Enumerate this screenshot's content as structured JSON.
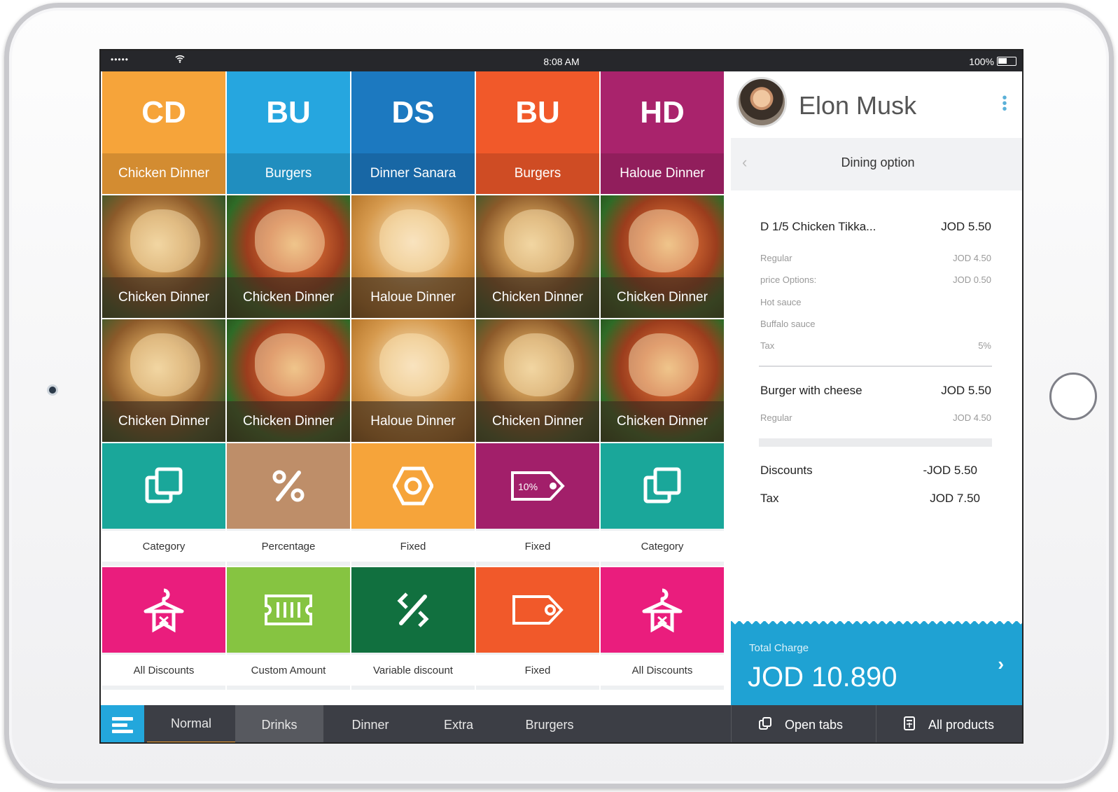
{
  "status_bar": {
    "signal": "•••••",
    "time": "8:08 AM",
    "battery": "100%"
  },
  "category_tiles": [
    {
      "abbr": "CD",
      "label": "Chicken Dinner",
      "color": "#f6a43a"
    },
    {
      "abbr": "BU",
      "label": "Burgers",
      "color": "#26a6df"
    },
    {
      "abbr": "DS",
      "label": "Dinner Sanara",
      "color": "#1c79c0"
    },
    {
      "abbr": "BU",
      "label": "Burgers",
      "color": "#f1592a"
    },
    {
      "abbr": "HD",
      "label": "Haloue Dinner",
      "color": "#a9236c"
    }
  ],
  "product_tiles_row1": [
    "Chicken Dinner",
    "Chicken Dinner",
    "Haloue Dinner",
    "Chicken Dinner",
    "Chicken Dinner"
  ],
  "product_tiles_row2": [
    "Chicken Dinner",
    "Chicken Dinner",
    "Haloue Dinner",
    "Chicken Dinner",
    "Chicken Dinner"
  ],
  "discount_tiles_row1": [
    {
      "label": "Category",
      "icon": "copy-icon",
      "color": "#1aa79a"
    },
    {
      "label": "Percentage",
      "icon": "percent-icon",
      "color": "#be8e69"
    },
    {
      "label": "Fixed",
      "icon": "hexagon-icon",
      "color": "#f6a43a"
    },
    {
      "label": "Fixed",
      "icon": "tag-10-percent-icon",
      "color": "#a21f6a",
      "tag_text": "10%"
    },
    {
      "label": "Category",
      "icon": "copy-icon",
      "color": "#1aa79a"
    }
  ],
  "discount_tiles_row2": [
    {
      "label": "All Discounts",
      "icon": "hanger-icon",
      "color": "#ea1d7d"
    },
    {
      "label": "Custom Amount",
      "icon": "ticket-icon",
      "color": "#86c441"
    },
    {
      "label": "Variable discount",
      "icon": "variable-percent-icon",
      "color": "#11703f"
    },
    {
      "label": "Fixed",
      "icon": "tag-icon",
      "color": "#f1592a"
    },
    {
      "label": "All Discounts",
      "icon": "hanger-icon",
      "color": "#ea1d7d"
    }
  ],
  "bottom_tabs": [
    "Normal",
    "Drinks",
    "Dinner",
    "Extra",
    "Brurgers"
  ],
  "bottom_right": {
    "open_tabs": "Open tabs",
    "all_products": "All products"
  },
  "user": {
    "name": "Elon Musk"
  },
  "dining_option": "Dining option",
  "order": {
    "item1": {
      "name": "D 1/5 Chicken Tikka...",
      "price": "JOD 5.50",
      "details": [
        {
          "label": "Regular",
          "value": "JOD 4.50"
        },
        {
          "label": "price Options:",
          "value": "JOD 0.50"
        },
        {
          "label": "Hot sauce",
          "value": ""
        },
        {
          "label": "Buffalo sauce",
          "value": ""
        },
        {
          "label": "Tax",
          "value": "5%"
        }
      ]
    },
    "item2": {
      "name": "Burger with cheese",
      "price": "JOD 5.50",
      "details": [
        {
          "label": "Regular",
          "value": "JOD 4.50"
        }
      ]
    },
    "discounts_label": "Discounts",
    "discounts_value": "-JOD 5.50",
    "tax_label": "Tax",
    "tax_value": "JOD 7.50"
  },
  "total": {
    "label": "Total Charge",
    "amount": "JOD 10.890"
  }
}
